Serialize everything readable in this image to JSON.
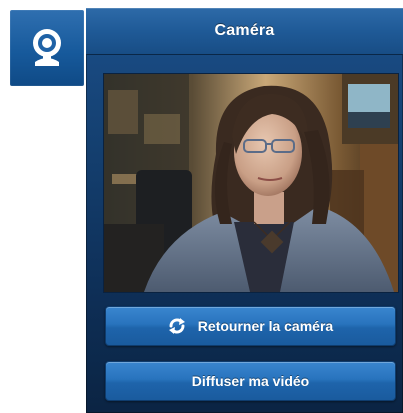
{
  "app_icon": {
    "icon": "webcam-icon",
    "color": "#1f62a6"
  },
  "header": {
    "title": "Caméra"
  },
  "video": {
    "description_icon": "camera-preview"
  },
  "buttons": {
    "flip_camera_label": "Retourner la caméra",
    "flip_camera_icon": "refresh-icon",
    "broadcast_label": "Diffuser ma vidéo"
  },
  "colors": {
    "panel": "#143f6f",
    "header": "#1f5a97",
    "button": "#2873bd",
    "text": "#ffffff"
  }
}
